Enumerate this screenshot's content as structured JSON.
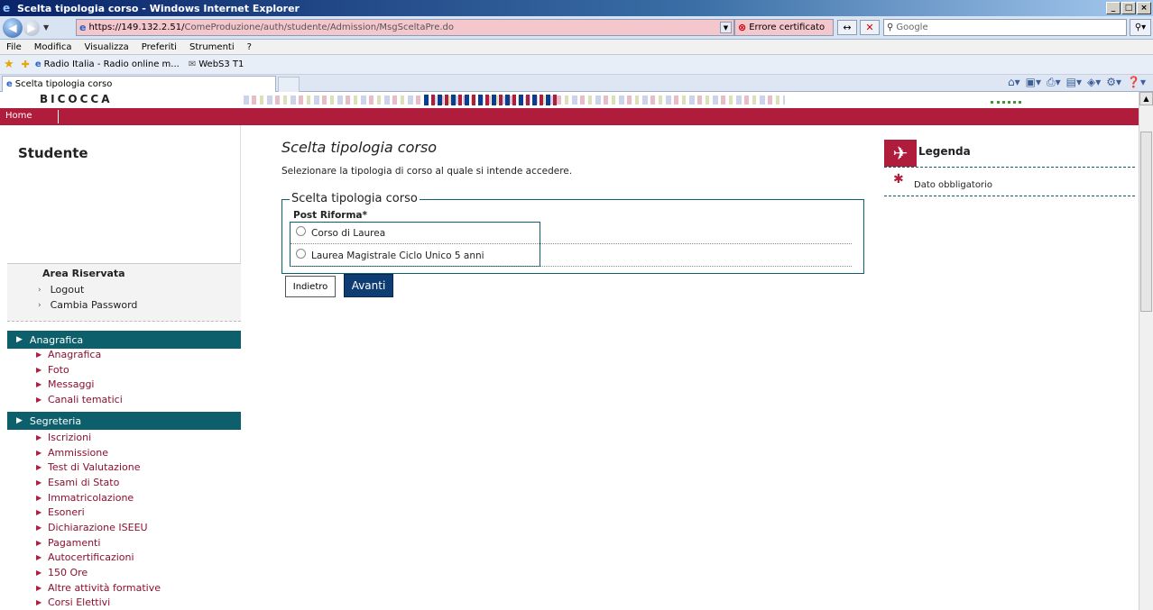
{
  "browser": {
    "window_title": "Scelta tipologia corso - Windows Internet Explorer",
    "url_host": "https://149.132.2.51/",
    "url_path": "ComeProduzione/auth/studente/Admission/MsgSceltaPre.do",
    "certificate_error": "Errore certificato",
    "search_placeholder": "Google",
    "menu": [
      "File",
      "Modifica",
      "Visualizza",
      "Preferiti",
      "Strumenti",
      "?"
    ],
    "favorites": [
      "Radio Italia - Radio online m...",
      "WebS3 T1"
    ],
    "tab_title": "Scelta tipologia corso"
  },
  "site": {
    "logo_text": "BICOCCA",
    "home_link": "Home"
  },
  "sidebar": {
    "title": "Studente",
    "area_riservata": {
      "title": "Area Riservata",
      "links": [
        "Logout",
        "Cambia Password"
      ]
    },
    "sections": [
      {
        "title": "Anagrafica",
        "items": [
          "Anagrafica",
          "Foto",
          "Messaggi",
          "Canali tematici"
        ]
      },
      {
        "title": "Segreteria",
        "items": [
          "Iscrizioni",
          "Ammissione",
          "Test di Valutazione",
          "Esami di Stato",
          "Immatricolazione",
          "Esoneri",
          "Dichiarazione ISEEU",
          "Pagamenti",
          "Autocertificazioni",
          "150 Ore",
          "Altre attività formative",
          "Corsi Elettivi"
        ]
      }
    ]
  },
  "main": {
    "title": "Scelta tipologia corso",
    "description": "Selezionare la tipologia di corso al quale si intende accedere.",
    "fieldset_legend": "Scelta tipologia corso",
    "group_label": "Post Riforma*",
    "options": [
      "Corso di Laurea",
      "Laurea Magistrale Ciclo Unico 5 anni"
    ],
    "back_button": "Indietro",
    "next_button": "Avanti"
  },
  "legenda": {
    "title": "Legenda",
    "items": [
      "Dato obbligatorio"
    ]
  },
  "colors": {
    "brand_red": "#b01d3c",
    "teal": "#0e5f6c",
    "button_blue": "#0e3d74"
  }
}
